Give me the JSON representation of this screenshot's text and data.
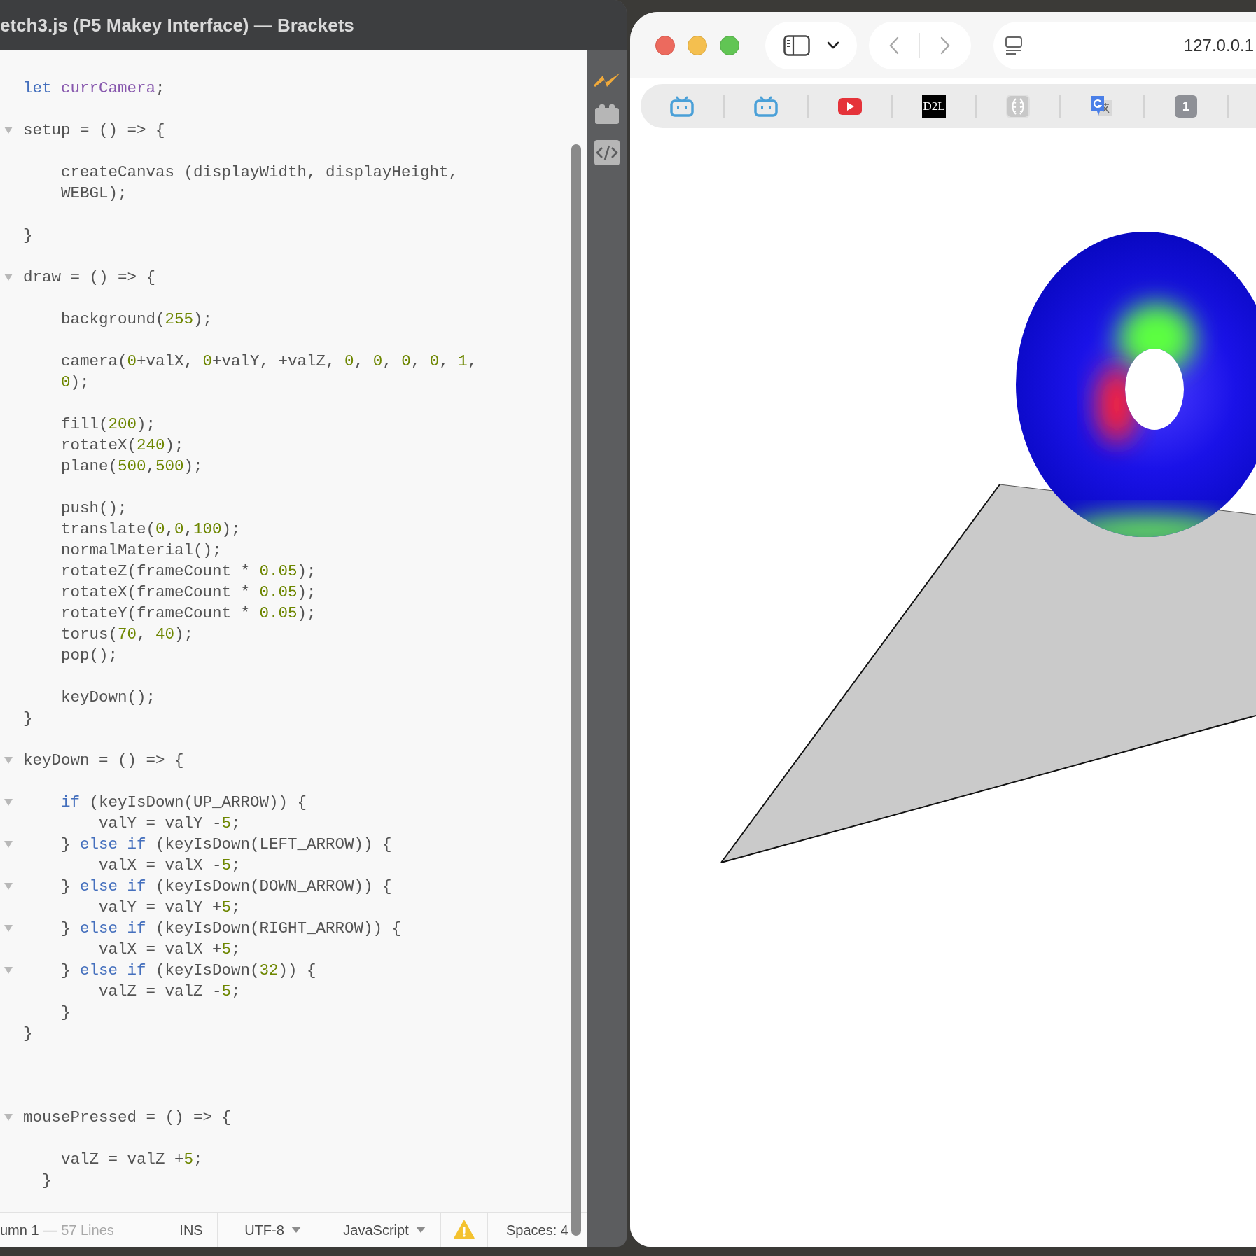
{
  "editor": {
    "title": "etch3.js (P5 Makey Interface) — Brackets",
    "lines": [
      {
        "kind": "code",
        "fold": false,
        "segments": [
          {
            "kind": "keyword",
            "text": "let"
          },
          {
            "kind": "variable",
            "text": " currCamera"
          },
          {
            "kind": "plain",
            "text": ";"
          }
        ]
      },
      {
        "kind": "blank"
      },
      {
        "kind": "code",
        "fold": true,
        "segments": [
          {
            "kind": "plain",
            "text": "setup = () => {"
          }
        ]
      },
      {
        "kind": "blank"
      },
      {
        "kind": "code",
        "fold": false,
        "segments": [
          {
            "kind": "plain",
            "text": "    createCanvas (displayWidth, displayHeight,"
          }
        ]
      },
      {
        "kind": "code",
        "fold": false,
        "segments": [
          {
            "kind": "plain",
            "text": "    WEBGL);"
          }
        ]
      },
      {
        "kind": "blank"
      },
      {
        "kind": "code",
        "fold": false,
        "segments": [
          {
            "kind": "plain",
            "text": "}"
          }
        ]
      },
      {
        "kind": "blank"
      },
      {
        "kind": "code",
        "fold": true,
        "segments": [
          {
            "kind": "plain",
            "text": "draw = () => {"
          }
        ]
      },
      {
        "kind": "blank"
      },
      {
        "kind": "code",
        "fold": false,
        "segments": [
          {
            "kind": "plain",
            "text": "    background("
          },
          {
            "kind": "number",
            "text": "255"
          },
          {
            "kind": "plain",
            "text": ");"
          }
        ]
      },
      {
        "kind": "blank"
      },
      {
        "kind": "code",
        "fold": false,
        "segments": [
          {
            "kind": "plain",
            "text": "    camera("
          },
          {
            "kind": "number",
            "text": "0"
          },
          {
            "kind": "plain",
            "text": "+valX, "
          },
          {
            "kind": "number",
            "text": "0"
          },
          {
            "kind": "plain",
            "text": "+valY, +valZ, "
          },
          {
            "kind": "number",
            "text": "0"
          },
          {
            "kind": "plain",
            "text": ", "
          },
          {
            "kind": "number",
            "text": "0"
          },
          {
            "kind": "plain",
            "text": ", "
          },
          {
            "kind": "number",
            "text": "0"
          },
          {
            "kind": "plain",
            "text": ", "
          },
          {
            "kind": "number",
            "text": "0"
          },
          {
            "kind": "plain",
            "text": ", "
          },
          {
            "kind": "number",
            "text": "1"
          },
          {
            "kind": "plain",
            "text": ","
          }
        ]
      },
      {
        "kind": "code",
        "fold": false,
        "segments": [
          {
            "kind": "number",
            "text": "    0"
          },
          {
            "kind": "plain",
            "text": ");"
          }
        ]
      },
      {
        "kind": "blank"
      },
      {
        "kind": "code",
        "fold": false,
        "segments": [
          {
            "kind": "plain",
            "text": "    fill("
          },
          {
            "kind": "number",
            "text": "200"
          },
          {
            "kind": "plain",
            "text": ");"
          }
        ]
      },
      {
        "kind": "code",
        "fold": false,
        "segments": [
          {
            "kind": "plain",
            "text": "    rotateX("
          },
          {
            "kind": "number",
            "text": "240"
          },
          {
            "kind": "plain",
            "text": ");"
          }
        ]
      },
      {
        "kind": "code",
        "fold": false,
        "segments": [
          {
            "kind": "plain",
            "text": "    plane("
          },
          {
            "kind": "number",
            "text": "500"
          },
          {
            "kind": "plain",
            "text": ","
          },
          {
            "kind": "number",
            "text": "500"
          },
          {
            "kind": "plain",
            "text": ");"
          }
        ]
      },
      {
        "kind": "blank"
      },
      {
        "kind": "code",
        "fold": false,
        "segments": [
          {
            "kind": "plain",
            "text": "    push();"
          }
        ]
      },
      {
        "kind": "code",
        "fold": false,
        "segments": [
          {
            "kind": "plain",
            "text": "    translate("
          },
          {
            "kind": "number",
            "text": "0"
          },
          {
            "kind": "plain",
            "text": ","
          },
          {
            "kind": "number",
            "text": "0"
          },
          {
            "kind": "plain",
            "text": ","
          },
          {
            "kind": "number",
            "text": "100"
          },
          {
            "kind": "plain",
            "text": ");"
          }
        ]
      },
      {
        "kind": "code",
        "fold": false,
        "segments": [
          {
            "kind": "plain",
            "text": "    normalMaterial();"
          }
        ]
      },
      {
        "kind": "code",
        "fold": false,
        "segments": [
          {
            "kind": "plain",
            "text": "    rotateZ(frameCount * "
          },
          {
            "kind": "number",
            "text": "0.05"
          },
          {
            "kind": "plain",
            "text": ");"
          }
        ]
      },
      {
        "kind": "code",
        "fold": false,
        "segments": [
          {
            "kind": "plain",
            "text": "    rotateX(frameCount * "
          },
          {
            "kind": "number",
            "text": "0.05"
          },
          {
            "kind": "plain",
            "text": ");"
          }
        ]
      },
      {
        "kind": "code",
        "fold": false,
        "segments": [
          {
            "kind": "plain",
            "text": "    rotateY(frameCount * "
          },
          {
            "kind": "number",
            "text": "0.05"
          },
          {
            "kind": "plain",
            "text": ");"
          }
        ]
      },
      {
        "kind": "code",
        "fold": false,
        "segments": [
          {
            "kind": "plain",
            "text": "    torus("
          },
          {
            "kind": "number",
            "text": "70"
          },
          {
            "kind": "plain",
            "text": ", "
          },
          {
            "kind": "number",
            "text": "40"
          },
          {
            "kind": "plain",
            "text": ");"
          }
        ]
      },
      {
        "kind": "code",
        "fold": false,
        "segments": [
          {
            "kind": "plain",
            "text": "    pop();"
          }
        ]
      },
      {
        "kind": "blank"
      },
      {
        "kind": "code",
        "fold": false,
        "segments": [
          {
            "kind": "plain",
            "text": "    keyDown();"
          }
        ]
      },
      {
        "kind": "code",
        "fold": false,
        "segments": [
          {
            "kind": "plain",
            "text": "}"
          }
        ]
      },
      {
        "kind": "blank"
      },
      {
        "kind": "code",
        "fold": true,
        "segments": [
          {
            "kind": "plain",
            "text": "keyDown = () => {"
          }
        ]
      },
      {
        "kind": "blank"
      },
      {
        "kind": "code",
        "fold": true,
        "segments": [
          {
            "kind": "keyword",
            "text": "    if"
          },
          {
            "kind": "plain",
            "text": " (keyIsDown(UP_ARROW)) {"
          }
        ]
      },
      {
        "kind": "code",
        "fold": false,
        "segments": [
          {
            "kind": "plain",
            "text": "        valY = valY -"
          },
          {
            "kind": "number",
            "text": "5"
          },
          {
            "kind": "plain",
            "text": ";"
          }
        ]
      },
      {
        "kind": "code",
        "fold": true,
        "segments": [
          {
            "kind": "plain",
            "text": "    } "
          },
          {
            "kind": "keyword",
            "text": "else if"
          },
          {
            "kind": "plain",
            "text": " (keyIsDown(LEFT_ARROW)) {"
          }
        ]
      },
      {
        "kind": "code",
        "fold": false,
        "segments": [
          {
            "kind": "plain",
            "text": "        valX = valX -"
          },
          {
            "kind": "number",
            "text": "5"
          },
          {
            "kind": "plain",
            "text": ";"
          }
        ]
      },
      {
        "kind": "code",
        "fold": true,
        "segments": [
          {
            "kind": "plain",
            "text": "    } "
          },
          {
            "kind": "keyword",
            "text": "else if"
          },
          {
            "kind": "plain",
            "text": " (keyIsDown(DOWN_ARROW)) {"
          }
        ]
      },
      {
        "kind": "code",
        "fold": false,
        "segments": [
          {
            "kind": "plain",
            "text": "        valY = valY +"
          },
          {
            "kind": "number",
            "text": "5"
          },
          {
            "kind": "plain",
            "text": ";"
          }
        ]
      },
      {
        "kind": "code",
        "fold": true,
        "segments": [
          {
            "kind": "plain",
            "text": "    } "
          },
          {
            "kind": "keyword",
            "text": "else if"
          },
          {
            "kind": "plain",
            "text": " (keyIsDown(RIGHT_ARROW)) {"
          }
        ]
      },
      {
        "kind": "code",
        "fold": false,
        "segments": [
          {
            "kind": "plain",
            "text": "        valX = valX +"
          },
          {
            "kind": "number",
            "text": "5"
          },
          {
            "kind": "plain",
            "text": ";"
          }
        ]
      },
      {
        "kind": "code",
        "fold": true,
        "segments": [
          {
            "kind": "plain",
            "text": "    } "
          },
          {
            "kind": "keyword",
            "text": "else if"
          },
          {
            "kind": "plain",
            "text": " (keyIsDown("
          },
          {
            "kind": "number",
            "text": "32"
          },
          {
            "kind": "plain",
            "text": ")) {"
          }
        ]
      },
      {
        "kind": "code",
        "fold": false,
        "segments": [
          {
            "kind": "plain",
            "text": "        valZ = valZ -"
          },
          {
            "kind": "number",
            "text": "5"
          },
          {
            "kind": "plain",
            "text": ";"
          }
        ]
      },
      {
        "kind": "code",
        "fold": false,
        "segments": [
          {
            "kind": "plain",
            "text": "    }"
          }
        ]
      },
      {
        "kind": "code",
        "fold": false,
        "segments": [
          {
            "kind": "plain",
            "text": "}"
          }
        ]
      },
      {
        "kind": "blank"
      },
      {
        "kind": "blank"
      },
      {
        "kind": "blank"
      },
      {
        "kind": "code",
        "fold": true,
        "segments": [
          {
            "kind": "plain",
            "text": "mousePressed = () => {"
          }
        ]
      },
      {
        "kind": "blank"
      },
      {
        "kind": "code",
        "fold": false,
        "segments": [
          {
            "kind": "plain",
            "text": "    valZ = valZ +"
          },
          {
            "kind": "number",
            "text": "5"
          },
          {
            "kind": "plain",
            "text": ";"
          }
        ]
      },
      {
        "kind": "code",
        "fold": false,
        "segments": [
          {
            "kind": "plain",
            "text": "  }"
          }
        ]
      }
    ],
    "status_bar": {
      "cursor": "umn 1",
      "line_count": "— 57 Lines",
      "mode": "INS",
      "encoding": "UTF-8",
      "language": "JavaScript",
      "warning": true,
      "indent": "Spaces: 4"
    }
  },
  "browser": {
    "address": "127.0.0.1",
    "favorites": [
      {
        "kind": "tv"
      },
      {
        "kind": "tv"
      },
      {
        "kind": "video"
      },
      {
        "kind": "label",
        "text": "D2L"
      },
      {
        "kind": "leaf"
      },
      {
        "kind": "translate"
      },
      {
        "kind": "count",
        "text": "1"
      }
    ]
  }
}
